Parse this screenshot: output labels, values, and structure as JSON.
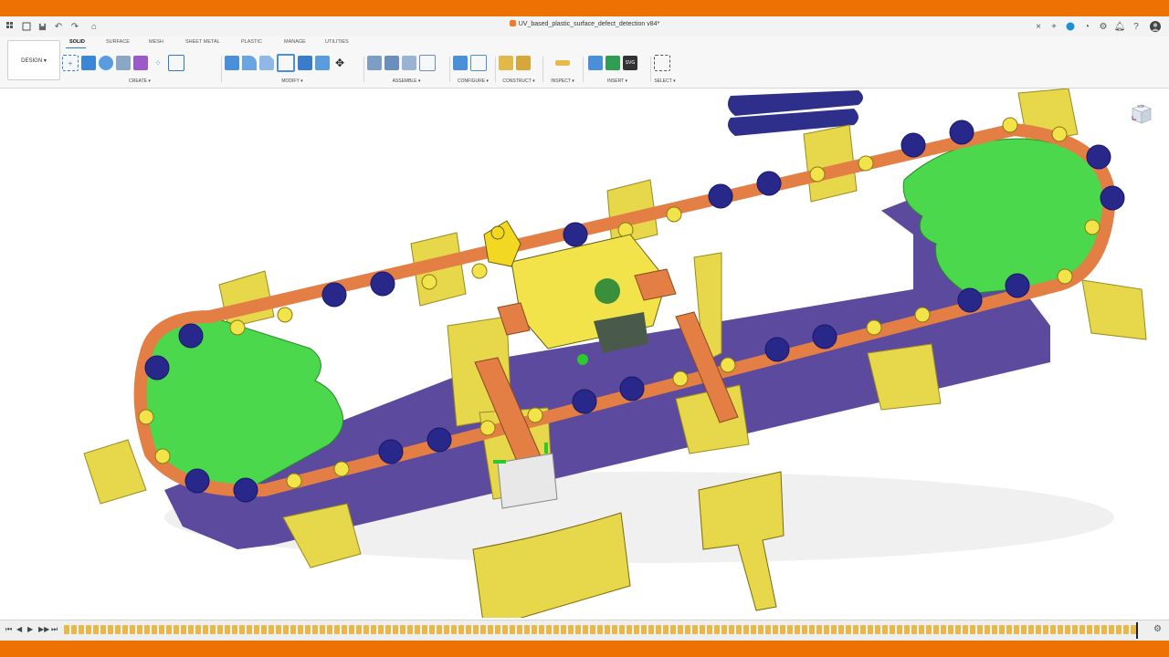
{
  "document": {
    "title": "UV_based_plastic_surface_defect_detection v84*"
  },
  "titlebar": {
    "grid_icon": "grid-icon",
    "file_icon": "file-icon",
    "save_icon": "save-icon",
    "undo_icon": "undo-icon",
    "redo_icon": "redo-icon",
    "home_icon": "home-icon",
    "close_tab": "×",
    "new_tab": "+"
  },
  "ribbon": {
    "workspace_label": "DESIGN ▾",
    "tabs": [
      "SOLID",
      "SURFACE",
      "MESH",
      "SHEET METAL",
      "PLASTIC",
      "MANAGE",
      "UTILITIES"
    ],
    "active_tab": "SOLID",
    "groups": [
      {
        "label": "CREATE ▾",
        "icons": [
          "create-sketch-icon",
          "extrude-icon",
          "revolve-icon",
          "box-icon",
          "form-icon",
          "pattern-icon",
          "section-icon"
        ]
      },
      {
        "label": "MODIFY ▾",
        "icons": [
          "press-pull-icon",
          "fillet-icon",
          "chamfer-icon",
          "shell-icon",
          "combine-icon",
          "align-icon",
          "move-icon"
        ]
      },
      {
        "label": "ASSEMBLE ▾",
        "icons": [
          "new-component-icon",
          "joint-icon",
          "as-built-joint-icon",
          "joint-origin-icon"
        ]
      },
      {
        "label": "CONFIGURE ▾",
        "icons": [
          "configure-icon",
          "table-icon"
        ]
      },
      {
        "label": "CONSTRUCT ▾",
        "icons": [
          "offset-plane-icon",
          "plane-angle-icon"
        ]
      },
      {
        "label": "INSPECT ▾",
        "icons": [
          "measure-icon"
        ]
      },
      {
        "label": "INSERT ▾",
        "icons": [
          "insert-derive-icon",
          "insert-image-icon",
          "insert-svg-icon"
        ]
      },
      {
        "label": "SELECT ▾",
        "icons": [
          "select-icon"
        ]
      }
    ]
  },
  "viewcube": {
    "face": "TOP"
  },
  "colors": {
    "accent": "#ee7203",
    "green_disc": "#4cd84c",
    "orange_link": "#e8844a",
    "yellow_part": "#e8d84a",
    "purple_base": "#6450a8",
    "blue_roller": "#27288a"
  },
  "timeline": {
    "controls": [
      "⏮",
      "◀",
      "▶",
      "▶▶",
      "⏭"
    ],
    "item_count": 150
  }
}
